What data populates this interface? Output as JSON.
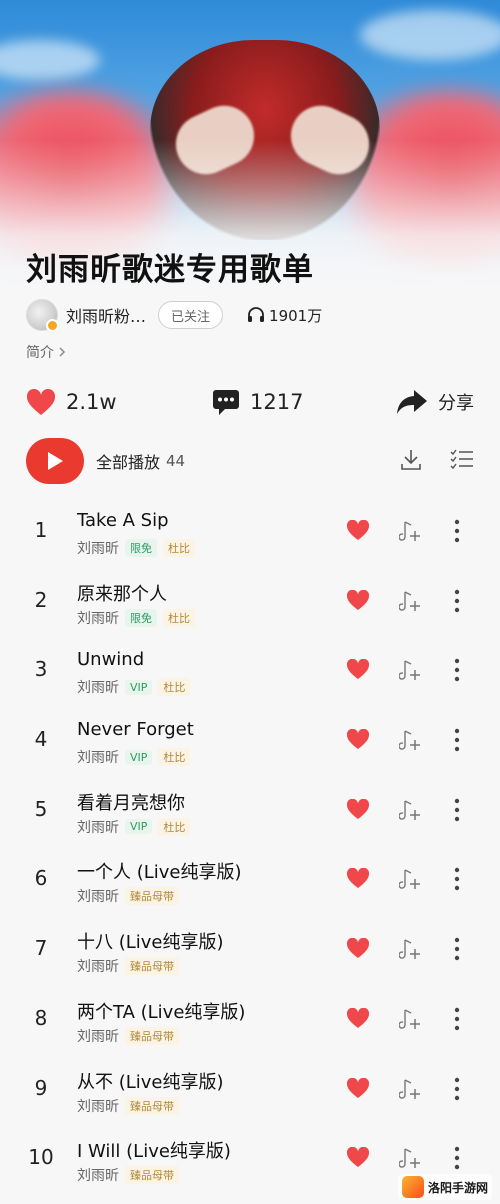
{
  "playlist": {
    "title": "刘雨昕歌迷专用歌单",
    "owner_name": "刘雨昕粉…",
    "follow_label": "已关注",
    "play_count": "1901万",
    "intro_label": "简介"
  },
  "actions": {
    "likes": "2.1w",
    "comments": "1217",
    "share_label": "分享"
  },
  "play_all": {
    "label": "全部播放",
    "count": "44"
  },
  "songs": [
    {
      "index": "1",
      "title": "Take A Sip",
      "artist": "刘雨昕",
      "tags": [
        "限免",
        "杜比"
      ]
    },
    {
      "index": "2",
      "title": "原来那个人",
      "artist": "刘雨昕",
      "tags": [
        "限免",
        "杜比"
      ]
    },
    {
      "index": "3",
      "title": "Unwind",
      "artist": "刘雨昕",
      "tags": [
        "VIP",
        "杜比"
      ]
    },
    {
      "index": "4",
      "title": "Never Forget",
      "artist": "刘雨昕",
      "tags": [
        "VIP",
        "杜比"
      ]
    },
    {
      "index": "5",
      "title": "看着月亮想你",
      "artist": "刘雨昕",
      "tags": [
        "VIP",
        "杜比"
      ]
    },
    {
      "index": "6",
      "title": "一个人 (Live纯享版)",
      "artist": "刘雨昕",
      "tags": [
        "臻品母带"
      ]
    },
    {
      "index": "7",
      "title": "十八 (Live纯享版)",
      "artist": "刘雨昕",
      "tags": [
        "臻品母带"
      ]
    },
    {
      "index": "8",
      "title": "两个TA (Live纯享版)",
      "artist": "刘雨昕",
      "tags": [
        "臻品母带"
      ]
    },
    {
      "index": "9",
      "title": "从不 (Live纯享版)",
      "artist": "刘雨昕",
      "tags": [
        "臻品母带"
      ]
    },
    {
      "index": "10",
      "title": "I Will (Live纯享版)",
      "artist": "刘雨昕",
      "tags": [
        "臻品母带"
      ]
    }
  ],
  "watermark": "洛阳手游网",
  "colors": {
    "accent_red": "#ea3a2f",
    "heart_red": "#f0484a",
    "tag_green": "#2f9a63",
    "tag_gold": "#b08a3c"
  },
  "icons": {
    "like": "heart-icon",
    "comment": "comment-icon",
    "share": "share-arrow-icon",
    "play": "play-icon",
    "download": "download-icon",
    "multi_select": "multi-select-icon",
    "plays": "headphones-icon"
  }
}
